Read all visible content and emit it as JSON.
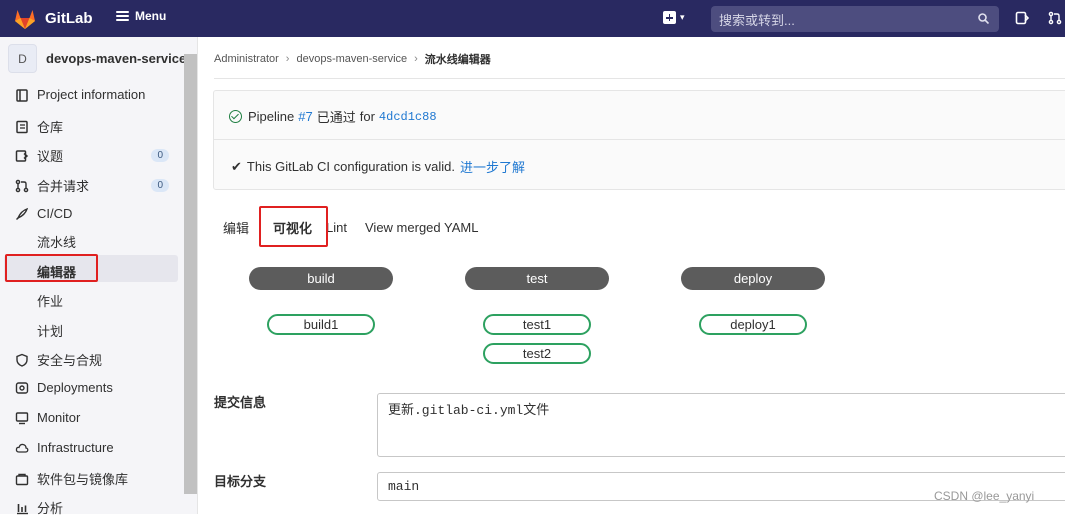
{
  "topbar": {
    "brand": "GitLab",
    "menu_label": "Menu",
    "search_placeholder": "搜索或转到...",
    "colors": {
      "bg": "#292961",
      "logo": "#fc6d26"
    }
  },
  "sidebar": {
    "project_avatar": "D",
    "project_name": "devops-maven-service",
    "items": [
      {
        "label": "Project information",
        "icon": "project-icon"
      },
      {
        "label": "仓库",
        "icon": "repository-icon"
      },
      {
        "label": "议题",
        "icon": "issues-icon",
        "badge": "0"
      },
      {
        "label": "合并请求",
        "icon": "merge-request-icon",
        "badge": "0"
      },
      {
        "label": "CI/CD",
        "icon": "rocket-icon"
      },
      {
        "label": "安全与合规",
        "icon": "shield-icon"
      },
      {
        "label": "Deployments",
        "icon": "deployments-icon"
      },
      {
        "label": "Monitor",
        "icon": "monitor-icon"
      },
      {
        "label": "Infrastructure",
        "icon": "cloud-icon"
      },
      {
        "label": "软件包与镜像库",
        "icon": "package-icon"
      },
      {
        "label": "分析",
        "icon": "analytics-icon"
      }
    ],
    "cicd_sub": [
      "流水线",
      "编辑器",
      "作业",
      "计划"
    ]
  },
  "breadcrumb": [
    "Administrator",
    "devops-maven-service",
    "流水线编辑器"
  ],
  "pipeline": {
    "prefix": "Pipeline",
    "id": "#7",
    "status": "已通过",
    "for_label": "for",
    "commit": "4dcd1c88",
    "valid_text": "This GitLab CI configuration is valid.",
    "learn_more": "进一步了解"
  },
  "tabs": [
    "编辑",
    "可视化",
    "Lint",
    "View merged YAML"
  ],
  "stages": [
    {
      "name": "build",
      "jobs": [
        "build1"
      ]
    },
    {
      "name": "test",
      "jobs": [
        "test1",
        "test2"
      ]
    },
    {
      "name": "deploy",
      "jobs": [
        "deploy1"
      ]
    }
  ],
  "form": {
    "commit_label": "提交信息",
    "commit_message": "更新.gitlab-ci.yml文件",
    "branch_label": "目标分支",
    "branch_value": "main"
  },
  "watermark": "CSDN @lee_yanyi"
}
